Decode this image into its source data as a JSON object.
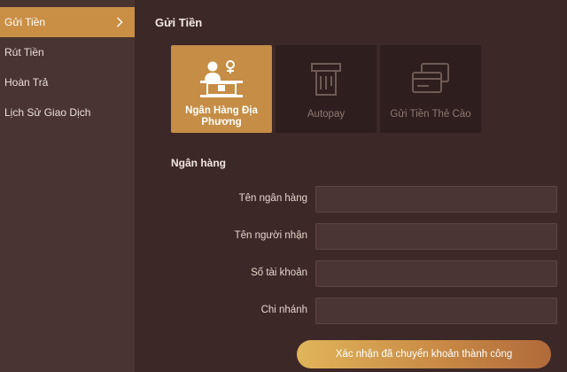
{
  "sidebar": {
    "items": [
      {
        "label": "Gửi Tiền",
        "active": true
      },
      {
        "label": "Rút Tiền",
        "active": false
      },
      {
        "label": "Hoàn Trả",
        "active": false
      },
      {
        "label": "Lịch Sử Giao Dịch",
        "active": false
      }
    ]
  },
  "main": {
    "title": "Gửi Tiền",
    "methods": [
      {
        "label": "Ngân Hàng Địa Phương",
        "icon": "bank-teller-icon",
        "active": true
      },
      {
        "label": "Autopay",
        "icon": "atm-icon",
        "active": false
      },
      {
        "label": "Gửi Tiền Thẻ Cào",
        "icon": "scratch-card-icon",
        "active": false
      }
    ],
    "section_label": "Ngân hàng",
    "fields": [
      {
        "label": "Tên ngân hàng",
        "value": ""
      },
      {
        "label": "Tên người nhận",
        "value": ""
      },
      {
        "label": "Số tài khoản",
        "value": ""
      },
      {
        "label": "Chi nhánh",
        "value": ""
      }
    ],
    "submit_label": "Xác nhận đã chuyển khoản thành công"
  },
  "colors": {
    "accent": "#c98f45",
    "background": "#3d2828",
    "sidebar": "#4a3432",
    "tile": "#2e1e1e"
  }
}
